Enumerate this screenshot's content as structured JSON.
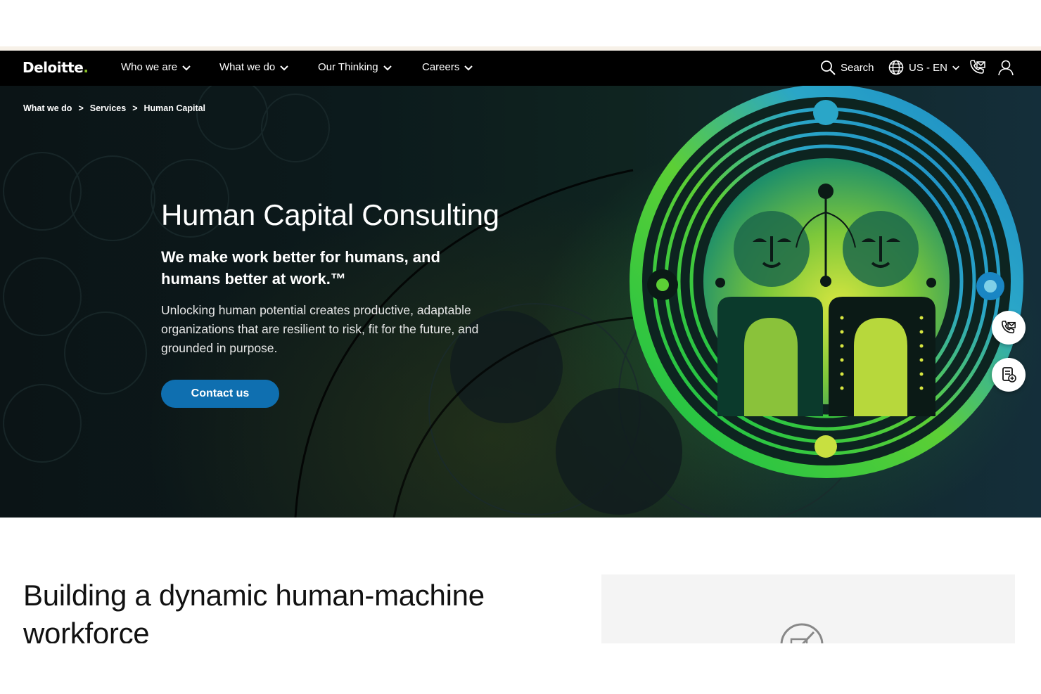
{
  "nav": {
    "logo_text": "Deloitte",
    "logo_dot": ".",
    "items": [
      {
        "label": "Who we are"
      },
      {
        "label": "What we do"
      },
      {
        "label": "Our Thinking"
      },
      {
        "label": "Careers"
      }
    ],
    "search_label": "Search",
    "locale_label": "US - EN",
    "icons": [
      "search-icon",
      "globe-icon",
      "contact-icon",
      "user-icon"
    ]
  },
  "breadcrumb": {
    "items": [
      "What we do",
      "Services",
      "Human Capital"
    ],
    "separator": ">"
  },
  "hero": {
    "title": "Human Capital Consulting",
    "subtitle": "We make work better for humans, and humans better at work.™",
    "description": "Unlocking human potential creates productive, adaptable organizations that are resilient to risk, fit for the future, and grounded in purpose.",
    "cta_label": "Contact us"
  },
  "floating_actions": [
    "contact-icon",
    "subscribe-icon"
  ],
  "section": {
    "title": "Building a dynamic human-machine workforce"
  },
  "colors": {
    "brand_green": "#86bc25",
    "cta_blue": "#0f6fb0",
    "nav_bg": "#000000"
  }
}
